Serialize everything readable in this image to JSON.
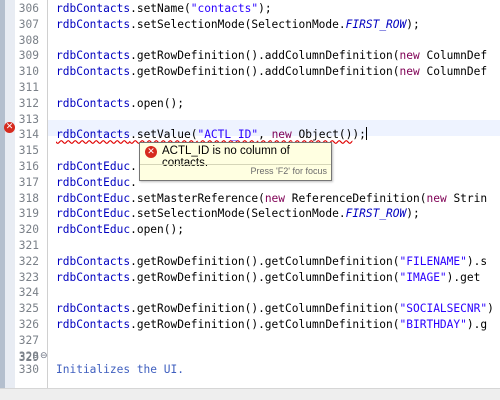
{
  "editor": {
    "lines": [
      {
        "num": "306",
        "text": [
          [
            "fld",
            "rdbContacts"
          ],
          [
            "",
            ".setName("
          ],
          [
            "str",
            "\"contacts\""
          ],
          [
            "",
            ");"
          ]
        ]
      },
      {
        "num": "307",
        "text": [
          [
            "fld",
            "rdbContacts"
          ],
          [
            "",
            ".setSelectionMode(SelectionMode."
          ],
          [
            "cst",
            "FIRST_ROW"
          ],
          [
            "",
            ");"
          ]
        ]
      },
      {
        "num": "308",
        "text": []
      },
      {
        "num": "309",
        "text": [
          [
            "fld",
            "rdbContacts"
          ],
          [
            "",
            ".getRowDefinition().addColumnDefinition("
          ],
          [
            "kw",
            "new"
          ],
          [
            "",
            " ColumnDef"
          ]
        ]
      },
      {
        "num": "310",
        "text": [
          [
            "fld",
            "rdbContacts"
          ],
          [
            "",
            ".getRowDefinition().addColumnDefinition("
          ],
          [
            "kw",
            "new"
          ],
          [
            "",
            " ColumnDef"
          ]
        ]
      },
      {
        "num": "311",
        "text": []
      },
      {
        "num": "312",
        "text": [
          [
            "fld",
            "rdbContacts"
          ],
          [
            "",
            ".open();"
          ]
        ]
      },
      {
        "num": "313",
        "text": []
      },
      {
        "num": "314",
        "text": [
          [
            "fld squig",
            "rdbContacts"
          ],
          [
            "squig",
            ".setValue("
          ],
          [
            "str squig",
            "\"ACTL_ID\""
          ],
          [
            "squig",
            ", "
          ],
          [
            "kw squig",
            "new"
          ],
          [
            "squig",
            " Object()"
          ],
          [
            "",
            ");"
          ]
        ]
      },
      {
        "num": "315",
        "text": []
      },
      {
        "num": "316",
        "text": [
          [
            "fld",
            "rdbContEduc"
          ],
          [
            "",
            "."
          ]
        ]
      },
      {
        "num": "317",
        "text": [
          [
            "fld",
            "rdbContEduc"
          ],
          [
            "",
            "."
          ]
        ]
      },
      {
        "num": "318",
        "text": [
          [
            "fld",
            "rdbContEduc"
          ],
          [
            "",
            ".setMasterReference("
          ],
          [
            "kw",
            "new"
          ],
          [
            "",
            " ReferenceDefinition("
          ],
          [
            "kw",
            "new"
          ],
          [
            "",
            " Strin"
          ]
        ]
      },
      {
        "num": "319",
        "text": [
          [
            "fld",
            "rdbContEduc"
          ],
          [
            "",
            ".setSelectionMode(SelectionMode."
          ],
          [
            "cst",
            "FIRST_ROW"
          ],
          [
            "",
            ");"
          ]
        ]
      },
      {
        "num": "320",
        "text": [
          [
            "fld",
            "rdbContEduc"
          ],
          [
            "",
            ".open();"
          ]
        ]
      },
      {
        "num": "321",
        "text": []
      },
      {
        "num": "322",
        "text": [
          [
            "fld",
            "rdbContacts"
          ],
          [
            "",
            ".getRowDefinition().getColumnDefinition("
          ],
          [
            "str",
            "\"FILENAME\""
          ],
          [
            "",
            ").s"
          ]
        ]
      },
      {
        "num": "323",
        "text": [
          [
            "fld",
            "rdbContacts"
          ],
          [
            "",
            ".getRowDefinition().getColumnDefinition("
          ],
          [
            "str",
            "\"IMAGE\""
          ],
          [
            "",
            ").get"
          ]
        ]
      },
      {
        "num": "324",
        "text": []
      },
      {
        "num": "325",
        "text": [
          [
            "fld",
            "rdbContacts"
          ],
          [
            "",
            ".getRowDefinition().getColumnDefinition("
          ],
          [
            "str",
            "\"SOCIALSECNR\""
          ],
          [
            "",
            ")"
          ]
        ]
      },
      {
        "num": "326",
        "text": [
          [
            "fld",
            "rdbContacts"
          ],
          [
            "",
            ".getRowDefinition().getColumnDefinition("
          ],
          [
            "str",
            "\"BIRTHDAY\""
          ],
          [
            "",
            ").g"
          ]
        ]
      },
      {
        "num": "327",
        "text": []
      },
      {
        "num": "328",
        "text": []
      },
      {
        "num": "329",
        "text": []
      },
      {
        "num": "330",
        "text": [
          [
            "cmt",
            "Initializes the UI."
          ]
        ]
      }
    ]
  },
  "tooltip": {
    "message": "ACTL_ID is no column of contacts.",
    "hint": "Press 'F2' for focus",
    "icon": "error-icon"
  },
  "gutter": {
    "error_icon": "error-marker-icon",
    "fold_icon": "fold-collapse-icon"
  },
  "colors": {
    "field": "#0000c0",
    "string": "#2a00ff",
    "keyword": "#7f0055",
    "comment": "#3f5fbf",
    "error": "#d62a1e",
    "tooltip_bg": "#ffffe1"
  }
}
